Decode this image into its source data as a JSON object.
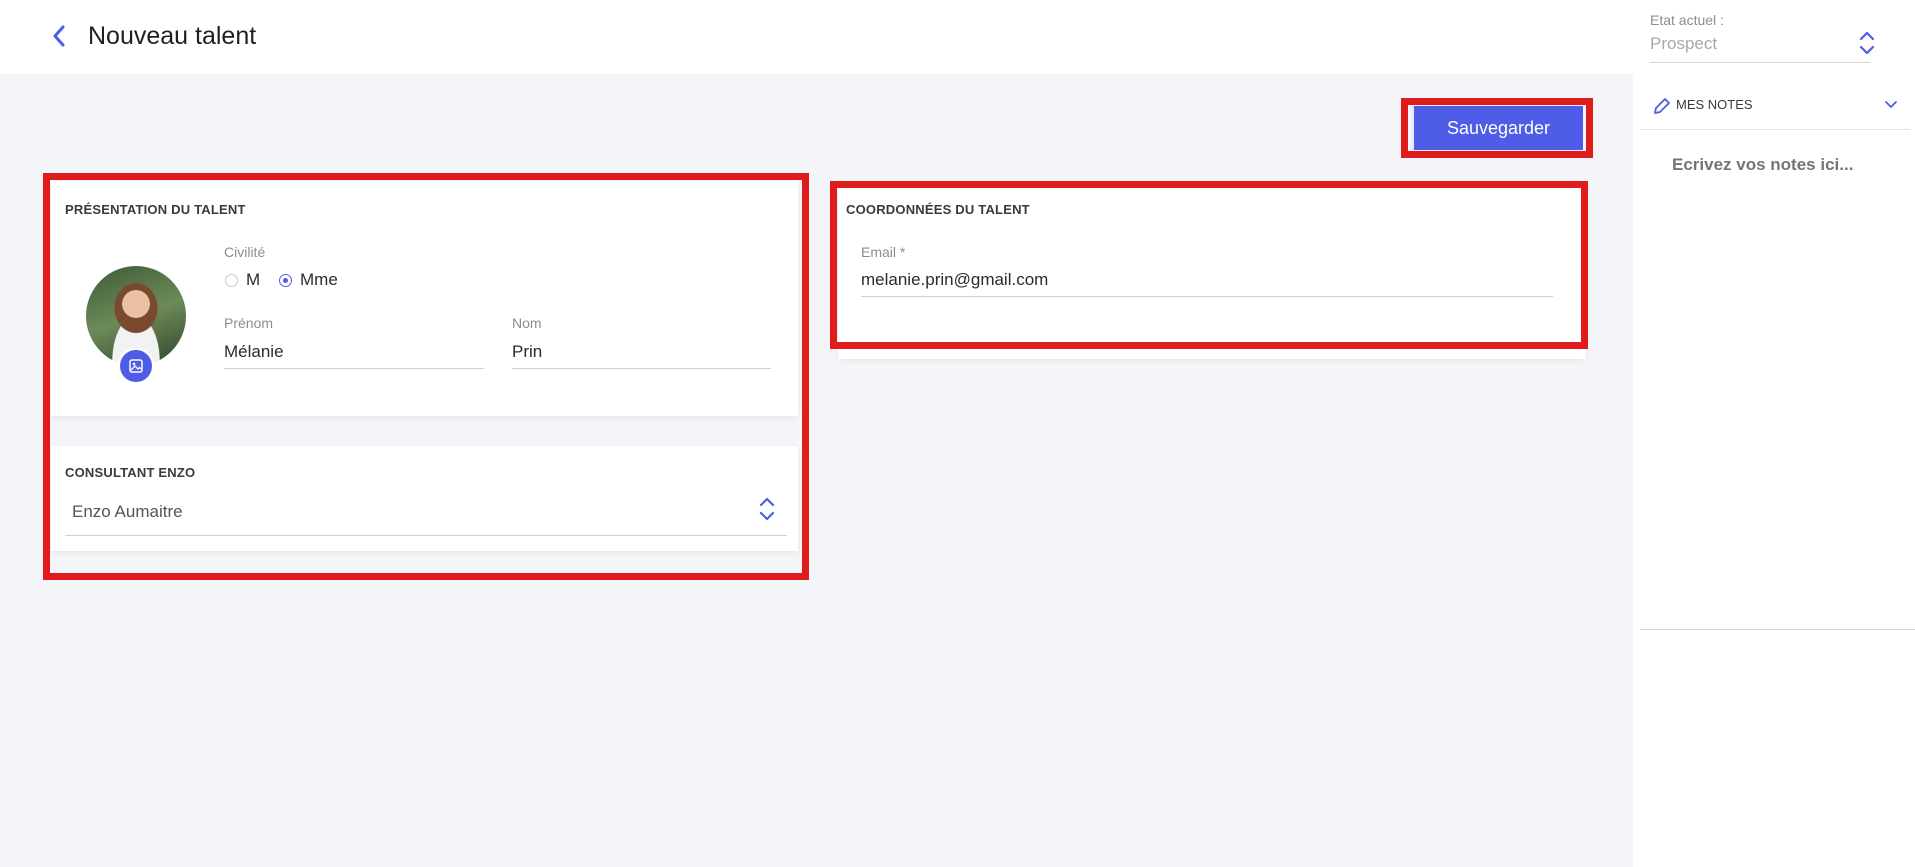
{
  "header": {
    "title": "Nouveau talent",
    "back_icon": "chevron-left-icon"
  },
  "toolbar": {
    "save_label": "Sauvegarder"
  },
  "presentation": {
    "title": "PRÉSENTATION DU TALENT",
    "civilite_label": "Civilité",
    "civilite_options": [
      "M",
      "Mme"
    ],
    "civilite_selected": "Mme",
    "prenom_label": "Prénom",
    "prenom_value": "Mélanie",
    "nom_label": "Nom",
    "nom_value": "Prin",
    "avatar_button_icon": "image-icon"
  },
  "consultant": {
    "title": "CONSULTANT ENZO",
    "value": "Enzo Aumaitre"
  },
  "coordonnees": {
    "title": "COORDONNÉES DU TALENT",
    "email_label": "Email *",
    "email_value": "melanie.prin@gmail.com"
  },
  "side": {
    "state_label": "Etat actuel :",
    "state_value": "Prospect",
    "notes_title": "MES NOTES",
    "notes_placeholder": "Ecrivez vos notes ici..."
  },
  "colors": {
    "accent": "#4e5ce8",
    "highlight": "#e01b1b",
    "background": "#f4f5f8"
  }
}
